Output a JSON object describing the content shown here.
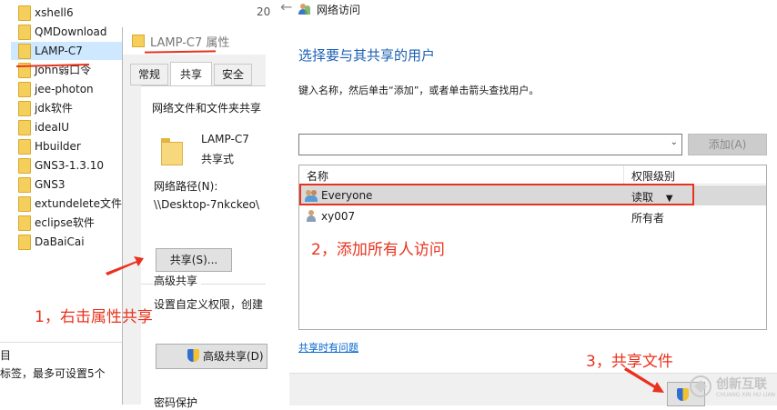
{
  "explorer": {
    "folders": [
      "xshell6",
      "QMDownload",
      "LAMP-C7",
      "John弱口令",
      "jee-photon",
      "jdk软件",
      "ideaIU",
      "Hbuilder",
      "GNS3-1.3.10",
      "GNS3",
      "extundelete文件",
      "eclipse软件",
      "DaBaiCai"
    ],
    "partial_date": "20",
    "bottom_fragment_1": "目",
    "bottom_fragment_2": "标签，最多可设置5个"
  },
  "properties": {
    "title": "LAMP-C7 属性",
    "tabs": [
      "常规",
      "共享",
      "安全"
    ],
    "section_title": "网络文件和文件夹共享",
    "folder_name": "LAMP-C7",
    "folder_status": "共享式",
    "path_label": "网络路径(N):",
    "path_value": "\\\\Desktop-7nkckeo\\",
    "share_button": "共享(S)...",
    "advanced_title": "高级共享",
    "advanced_desc": "设置自定义权限，创建",
    "advanced_button": "高级共享(D)",
    "password_title": "密码保护"
  },
  "network_access": {
    "window_title": "网络访问",
    "heading": "选择要与其共享的用户",
    "instruction": "键入名称，然后单击“添加”，或者单击箭头查找用户。",
    "input_value": "",
    "add_button": "添加(A)",
    "columns": [
      "名称",
      "权限级别"
    ],
    "users": [
      {
        "name": "Everyone",
        "permission": "读取",
        "has_dropdown": true
      },
      {
        "name": "xy007",
        "permission": "所有者",
        "has_dropdown": false
      }
    ],
    "help_link": "共享时有问题"
  },
  "annotations": {
    "step1": "1，右击属性共享",
    "step2": "2，添加所有人访问",
    "step3": "3，共享文件"
  },
  "watermark": {
    "brand": "创新互联",
    "sub": "CHUANG XIN HU LIAN"
  },
  "colors": {
    "accent": "#e8321d",
    "heading_blue": "#1a5fb4",
    "link": "#0066cc",
    "selection": "#cde8ff"
  }
}
